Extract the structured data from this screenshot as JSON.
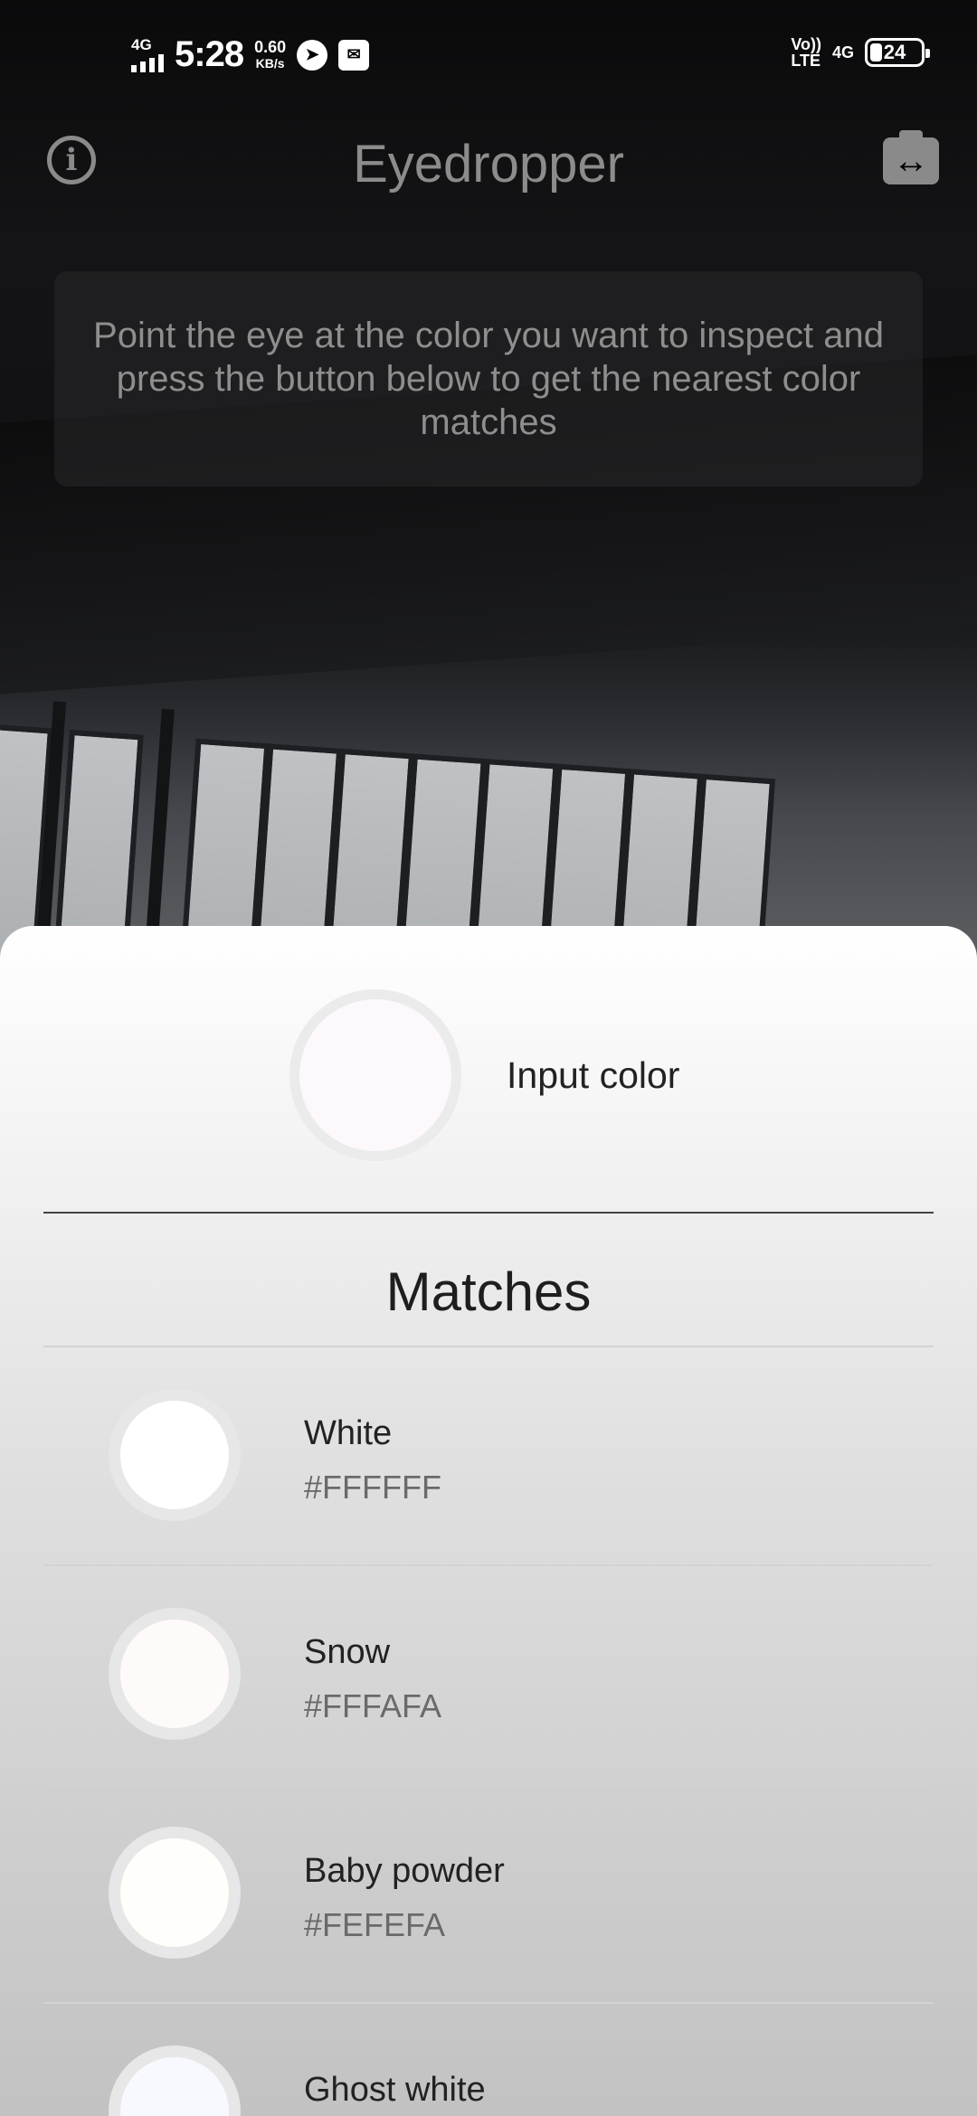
{
  "status_bar": {
    "network_type": "4G",
    "time": "5:28",
    "speed_value": "0.60",
    "speed_unit": "KB/s",
    "volte_top": "Vo))",
    "volte_bottom": "LTE",
    "network_right": "4G",
    "battery_level": "24"
  },
  "app_bar": {
    "title": "Eyedropper",
    "info_icon": "info-icon",
    "switch_camera_icon": "switch-camera-icon"
  },
  "hint": {
    "text": "Point the eye at the color you want to inspect and press the button below to get the nearest color matches"
  },
  "input": {
    "label": "Input color",
    "color": "#FCF8FB"
  },
  "matches": {
    "title": "Matches",
    "items": [
      {
        "name": "White",
        "hex": "#FFFFFF",
        "color": "#FFFFFF"
      },
      {
        "name": "Snow",
        "hex": "#FFFAFA",
        "color": "#FFFAFA"
      },
      {
        "name": "Baby powder",
        "hex": "#FEFEFA",
        "color": "#FEFEFA"
      },
      {
        "name": "Ghost white",
        "hex": "",
        "color": "#F8F8FF"
      }
    ]
  }
}
